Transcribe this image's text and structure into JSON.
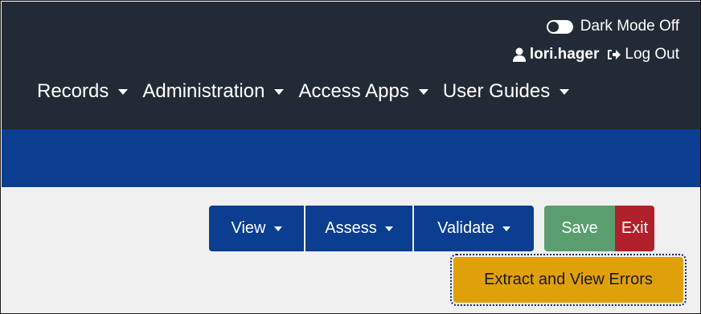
{
  "header": {
    "dark_mode_label": "Dark Mode Off",
    "username": "lori.hager",
    "logout_label": "Log Out"
  },
  "nav": {
    "items": [
      {
        "label": "Records"
      },
      {
        "label": "Administration"
      },
      {
        "label": "Access Apps"
      },
      {
        "label": "User Guides"
      }
    ]
  },
  "toolbar": {
    "view_label": "View",
    "assess_label": "Assess",
    "validate_label": "Validate",
    "save_label": "Save",
    "exit_label": "Exit",
    "extract_label": "Extract and View Errors"
  },
  "icons": {
    "user": "user-icon",
    "logout": "sign-out-icon",
    "caret": "caret-down-icon"
  },
  "colors": {
    "navbar_bg": "#222b35",
    "brand_blue": "#0b3d91",
    "save_green": "#5a9e6f",
    "exit_red": "#b0202a",
    "extract_amber": "#e0a00a",
    "content_bg": "#f0f0f0"
  }
}
